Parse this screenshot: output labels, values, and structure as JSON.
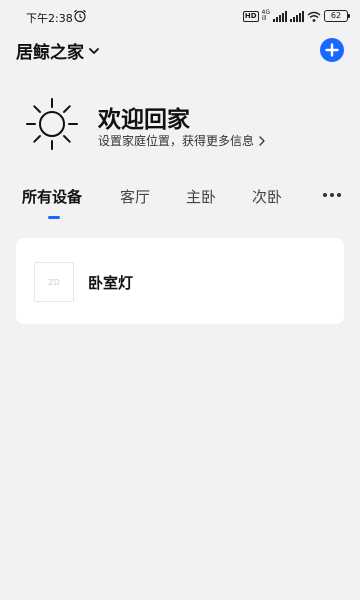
{
  "status_bar": {
    "time": "下午2:38",
    "hd": "HD",
    "network_top": "4G",
    "network_bottom": "ill",
    "battery": "62"
  },
  "header": {
    "home_name": "居鲸之家",
    "add_icon": "plus-icon",
    "accent_color": "#1769ff"
  },
  "welcome": {
    "title": "欢迎回家",
    "subtitle": "设置家庭位置，获得更多信息",
    "icon": "sun-icon"
  },
  "tabs": [
    {
      "label": "所有设备",
      "active": true
    },
    {
      "label": "客厅",
      "active": false
    },
    {
      "label": "主卧",
      "active": false
    },
    {
      "label": "次卧",
      "active": false
    }
  ],
  "devices": [
    {
      "name": "卧室灯",
      "thumb_text": "ZD"
    }
  ]
}
